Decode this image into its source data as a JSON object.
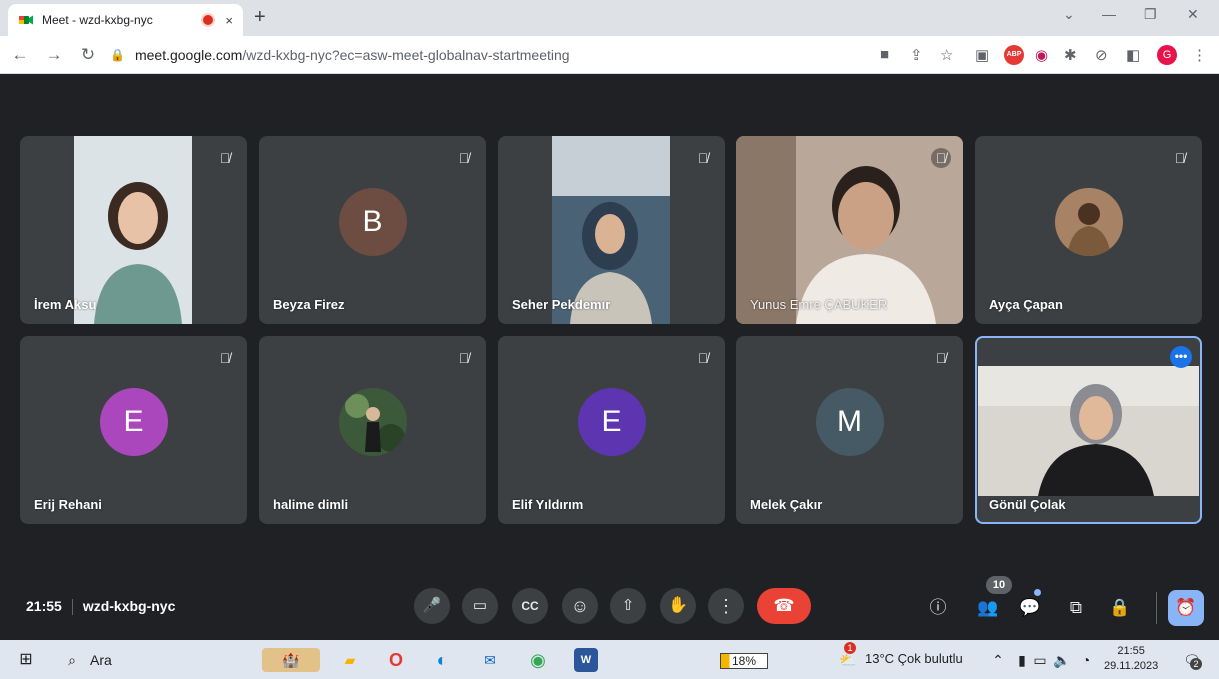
{
  "browser": {
    "tab_title": "Meet - wzd-kxbg-nyc",
    "tab_close": "×",
    "new_tab": "+",
    "url_host": "meet.google.com",
    "url_path": "/wzd-kxbg-nyc?ec=asw-meet-globalnav-startmeeting",
    "profile_initial": "G",
    "abp_label": "ABP"
  },
  "participants": [
    {
      "name": "İrem Aksu",
      "type": "video"
    },
    {
      "name": "Beyza Firez",
      "type": "initial",
      "initial": "B",
      "color": "#6d4c41"
    },
    {
      "name": "Seher Pekdemır",
      "type": "video"
    },
    {
      "name": "Yunus Emre ÇABUKER",
      "type": "video"
    },
    {
      "name": "Ayça Çapan",
      "type": "photo"
    },
    {
      "name": "Erij Rehani",
      "type": "initial",
      "initial": "E",
      "color": "#ab47bc"
    },
    {
      "name": "halime dimli",
      "type": "photo"
    },
    {
      "name": "Elif Yıldırım",
      "type": "initial",
      "initial": "E",
      "color": "#5e35b1"
    },
    {
      "name": "Melek Çakır",
      "type": "initial",
      "initial": "M",
      "color": "#455a64"
    },
    {
      "name": "Gönül Çolak",
      "type": "video"
    }
  ],
  "meeting": {
    "time": "21:55",
    "code": "wzd-kxbg-nyc",
    "people_count": "10",
    "more_dots": "•••"
  },
  "taskbar": {
    "search_label": "Ara",
    "battery": "18%",
    "weather": "13°C  Çok bulutlu",
    "clock_time": "21:55",
    "clock_date": "29.11.2023",
    "notif_count": "2",
    "weather_badge": "1"
  },
  "colors": {
    "accent": "#8ab4f8",
    "hangup": "#ea4335",
    "stage_bg": "#202124",
    "tile_bg": "#3c4043"
  }
}
